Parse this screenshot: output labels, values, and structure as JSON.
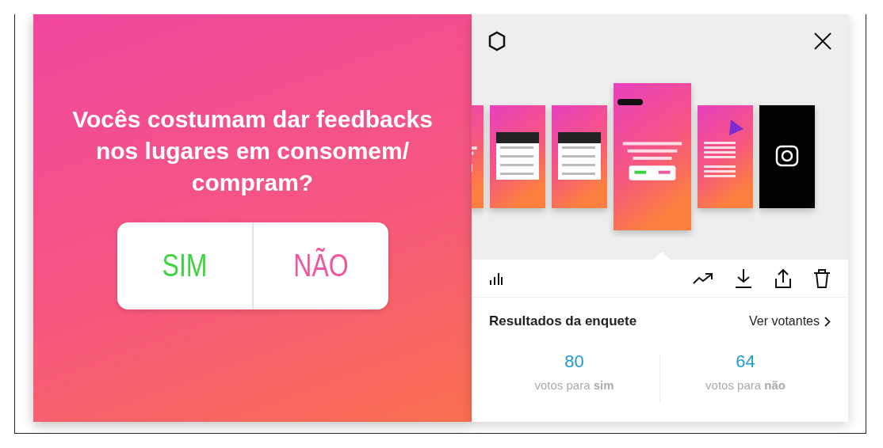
{
  "story": {
    "question": "Vocês costumam dar feedbacks nos lugares em consomem/ compram?",
    "options": [
      {
        "label": "SIM",
        "color": "#3fd33f"
      },
      {
        "label": "NÃO",
        "color": "#f2559f"
      }
    ]
  },
  "thumbnails": [
    {
      "kind": "poll",
      "selected": false
    },
    {
      "kind": "list",
      "selected": false
    },
    {
      "kind": "list",
      "selected": false
    },
    {
      "kind": "poll",
      "selected": true
    },
    {
      "kind": "text",
      "selected": false
    },
    {
      "kind": "camera",
      "selected": false
    }
  ],
  "results": {
    "title": "Resultados da enquete",
    "link": "Ver votantes",
    "options": [
      {
        "count": "80",
        "label": "votos para **sim**"
      },
      {
        "count": "64",
        "label": "votos para **não**"
      }
    ]
  }
}
